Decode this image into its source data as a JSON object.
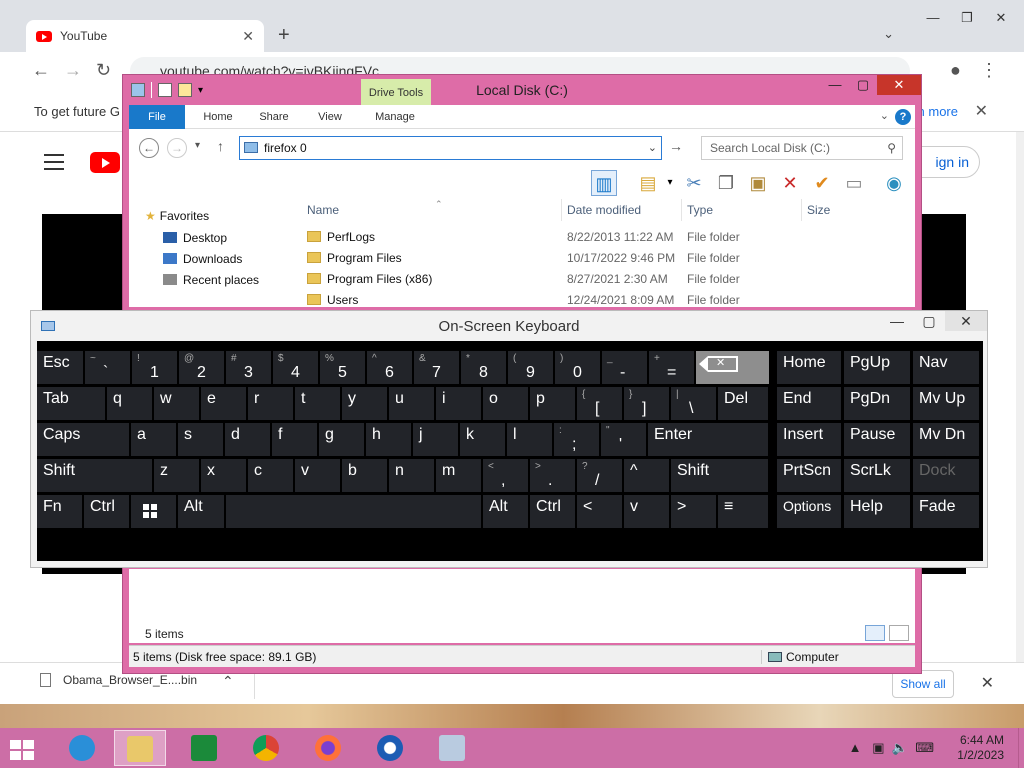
{
  "browser": {
    "tab_title": "YouTube",
    "url": "youtube.com/watch?v=jvBKjjngFVc",
    "infobar_text": "To get future G",
    "infobar_link": "n more",
    "signin_label": "ign in",
    "download_file": "Obama_Browser_E....bin",
    "show_all": "Show all"
  },
  "explorer": {
    "title": "Local Disk (C:)",
    "context_tab": "Drive Tools",
    "ribbon_tabs": [
      "File",
      "Home",
      "Share",
      "View",
      "Manage"
    ],
    "address_value": "firefox 0",
    "search_placeholder": "Search Local Disk (C:)",
    "nav": {
      "favorites": "Favorites",
      "items": [
        "Desktop",
        "Downloads",
        "Recent places"
      ]
    },
    "columns": [
      "Name",
      "Date modified",
      "Type",
      "Size"
    ],
    "files": [
      {
        "name": "PerfLogs",
        "date": "8/22/2013 11:22 AM",
        "type": "File folder"
      },
      {
        "name": "Program Files",
        "date": "10/17/2022 9:46 PM",
        "type": "File folder"
      },
      {
        "name": "Program Files (x86)",
        "date": "8/27/2021 2:30 AM",
        "type": "File folder"
      },
      {
        "name": "Users",
        "date": "12/24/2021 8:09 AM",
        "type": "File folder"
      }
    ],
    "items_count": "5 items",
    "status_left": "5 items (Disk free space: 89.1 GB)",
    "status_right": "Computer"
  },
  "osk": {
    "title": "On-Screen Keyboard",
    "rows": [
      [
        {
          "s": "",
          "m": "Esc"
        },
        {
          "s": "~",
          "m": "`"
        },
        {
          "s": "!",
          "m": "1"
        },
        {
          "s": "@",
          "m": "2"
        },
        {
          "s": "#",
          "m": "3"
        },
        {
          "s": "$",
          "m": "4"
        },
        {
          "s": "%",
          "m": "5"
        },
        {
          "s": "^",
          "m": "6"
        },
        {
          "s": "&",
          "m": "7"
        },
        {
          "s": "*",
          "m": "8"
        },
        {
          "s": "(",
          "m": "9"
        },
        {
          "s": ")",
          "m": "0"
        },
        {
          "s": "_",
          "m": "-"
        },
        {
          "s": "+",
          "m": "="
        }
      ],
      [
        {
          "m": "Tab"
        },
        {
          "m": "q"
        },
        {
          "m": "w"
        },
        {
          "m": "e"
        },
        {
          "m": "r"
        },
        {
          "m": "t"
        },
        {
          "m": "y"
        },
        {
          "m": "u"
        },
        {
          "m": "i"
        },
        {
          "m": "o"
        },
        {
          "m": "p"
        },
        {
          "s": "{",
          "m": "["
        },
        {
          "s": "}",
          "m": "]"
        },
        {
          "s": "|",
          "m": "\\"
        },
        {
          "m": "Del"
        }
      ],
      [
        {
          "m": "Caps"
        },
        {
          "m": "a"
        },
        {
          "m": "s"
        },
        {
          "m": "d"
        },
        {
          "m": "f"
        },
        {
          "m": "g"
        },
        {
          "m": "h"
        },
        {
          "m": "j"
        },
        {
          "m": "k"
        },
        {
          "m": "l"
        },
        {
          "s": ":",
          "m": ";"
        },
        {
          "s": "\"",
          "m": "'"
        },
        {
          "m": "Enter"
        }
      ],
      [
        {
          "m": "Shift"
        },
        {
          "m": "z"
        },
        {
          "m": "x"
        },
        {
          "m": "c"
        },
        {
          "m": "v"
        },
        {
          "m": "b"
        },
        {
          "m": "n"
        },
        {
          "m": "m"
        },
        {
          "s": "<",
          "m": ","
        },
        {
          "s": ">",
          "m": "."
        },
        {
          "s": "?",
          "m": "/"
        },
        {
          "m": "^"
        },
        {
          "m": "Shift"
        }
      ],
      [
        {
          "m": "Fn"
        },
        {
          "m": "Ctrl"
        },
        {
          "m": ""
        },
        {
          "m": "Alt"
        },
        {
          "m": ""
        },
        {
          "m": "Alt"
        },
        {
          "m": "Ctrl"
        },
        {
          "m": "<"
        },
        {
          "m": "v"
        },
        {
          "m": ">"
        },
        {
          "m": "≡"
        }
      ]
    ],
    "side_keys": [
      [
        "Home",
        "PgUp",
        "Nav"
      ],
      [
        "End",
        "PgDn",
        "Mv Up"
      ],
      [
        "Insert",
        "Pause",
        "Mv Dn"
      ],
      [
        "PrtScn",
        "ScrLk",
        "Dock"
      ],
      [
        "Options",
        "Help",
        "Fade"
      ]
    ]
  },
  "taskbar": {
    "time": "6:44 AM",
    "date": "1/2/2023"
  },
  "colors": {
    "accent_pink": "#de6ca7",
    "taskbar": "#cc6ea6",
    "ribbon_file": "#1979ca",
    "drive_tools": "#d7ecaa"
  }
}
